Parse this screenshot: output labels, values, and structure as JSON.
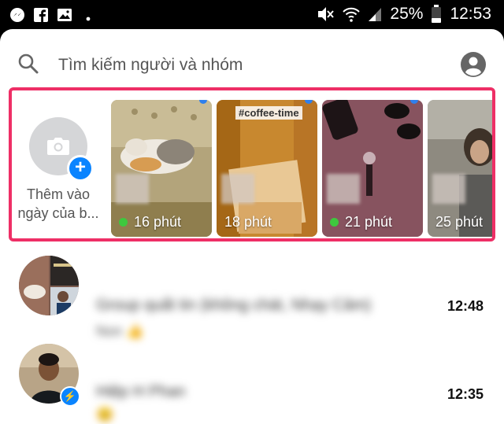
{
  "status_bar": {
    "battery": "25%",
    "time": "12:53",
    "left_icons": [
      "messenger-icon",
      "facebook-icon",
      "gallery-icon",
      "more-dots-icon"
    ],
    "right_icons": [
      "mute-icon",
      "wifi-icon",
      "signal-icon",
      "battery-icon"
    ]
  },
  "search": {
    "placeholder": "Tìm kiếm người và nhóm"
  },
  "stories": {
    "add_label": "Thêm vào ngày của b...",
    "items": [
      {
        "time": "16 phút",
        "online": true,
        "unseen": true,
        "tag": ""
      },
      {
        "time": "18 phút",
        "online": false,
        "unseen": true,
        "tag": "#coffee-time"
      },
      {
        "time": "21 phút",
        "online": true,
        "unseen": true,
        "tag": ""
      },
      {
        "time": "25 phút",
        "online": false,
        "unseen": false,
        "tag": ""
      }
    ],
    "highlight_color": "#ee2f66"
  },
  "conversations": [
    {
      "name": "Group quất tin (không chát, Nhạy Cảm)",
      "snippet": "Non 👍",
      "time": "12:48"
    },
    {
      "name": "Hiệp H Phan",
      "snippet": "😊",
      "time": "12:35"
    }
  ],
  "colors": {
    "accent": "#0a84ff",
    "online": "#3ec83e"
  }
}
